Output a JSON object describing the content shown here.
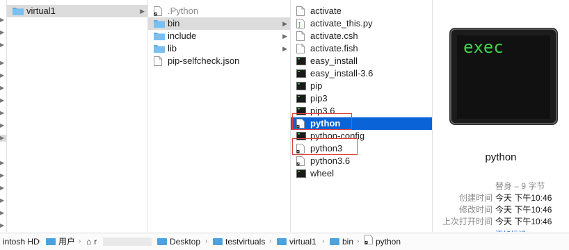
{
  "columns": {
    "col1": [
      {
        "label": "virtual1",
        "icon": "folder-icon",
        "chevron": true,
        "selected": "grey"
      }
    ],
    "col2": [
      {
        "label": ".Python",
        "icon": "alias-file-icon",
        "dim": true
      },
      {
        "label": "bin",
        "icon": "folder-icon",
        "chevron": true,
        "selected": "grey"
      },
      {
        "label": "include",
        "icon": "folder-icon",
        "chevron": true
      },
      {
        "label": "lib",
        "icon": "folder-icon",
        "chevron": true
      },
      {
        "label": "pip-selfcheck.json",
        "icon": "document-icon"
      }
    ],
    "col3": [
      {
        "label": "activate",
        "icon": "document-icon"
      },
      {
        "label": "activate_this.py",
        "icon": "python-script-icon"
      },
      {
        "label": "activate.csh",
        "icon": "document-icon"
      },
      {
        "label": "activate.fish",
        "icon": "document-icon"
      },
      {
        "label": "easy_install",
        "icon": "terminal-exec-icon"
      },
      {
        "label": "easy_install-3.6",
        "icon": "terminal-exec-icon"
      },
      {
        "label": "pip",
        "icon": "terminal-exec-icon"
      },
      {
        "label": "pip3",
        "icon": "terminal-exec-icon"
      },
      {
        "label": "pip3.6",
        "icon": "terminal-exec-icon"
      },
      {
        "label": "python",
        "icon": "alias-file-icon",
        "selected": "blue",
        "boxed": true
      },
      {
        "label": "python-config",
        "icon": "terminal-exec-icon"
      },
      {
        "label": "python3",
        "icon": "alias-file-icon",
        "boxed": true
      },
      {
        "label": "python3.6",
        "icon": "alias-file-icon"
      },
      {
        "label": "wheel",
        "icon": "terminal-exec-icon"
      }
    ]
  },
  "preview": {
    "icon_text": "exec",
    "name": "python",
    "kind": "替身 – 9 字节",
    "meta": [
      {
        "key": "创建时间",
        "value": "今天 下午10:46"
      },
      {
        "key": "修改时间",
        "value": "今天 下午10:46"
      },
      {
        "key": "上次打开时间",
        "value": "今天 下午10:46"
      }
    ],
    "add_tag": "添加标记"
  },
  "pathbar": [
    {
      "label": "intosh HD",
      "icon": ""
    },
    {
      "label": "用户",
      "icon": "user-folder-icon"
    },
    {
      "label": "r",
      "icon": "home-icon"
    },
    {
      "label": "Desktop",
      "icon": "folder-icon"
    },
    {
      "label": "testvirtuals",
      "icon": "folder-icon"
    },
    {
      "label": "virtual1",
      "icon": "folder-icon"
    },
    {
      "label": "bin",
      "icon": "folder-icon"
    },
    {
      "label": "python",
      "icon": "alias-file-icon"
    }
  ],
  "colors": {
    "selection_blue": "#0a64d8",
    "folder_blue": "#4aa3df",
    "highlight_box": "#e0413a",
    "exec_green": "#3fd34a"
  }
}
